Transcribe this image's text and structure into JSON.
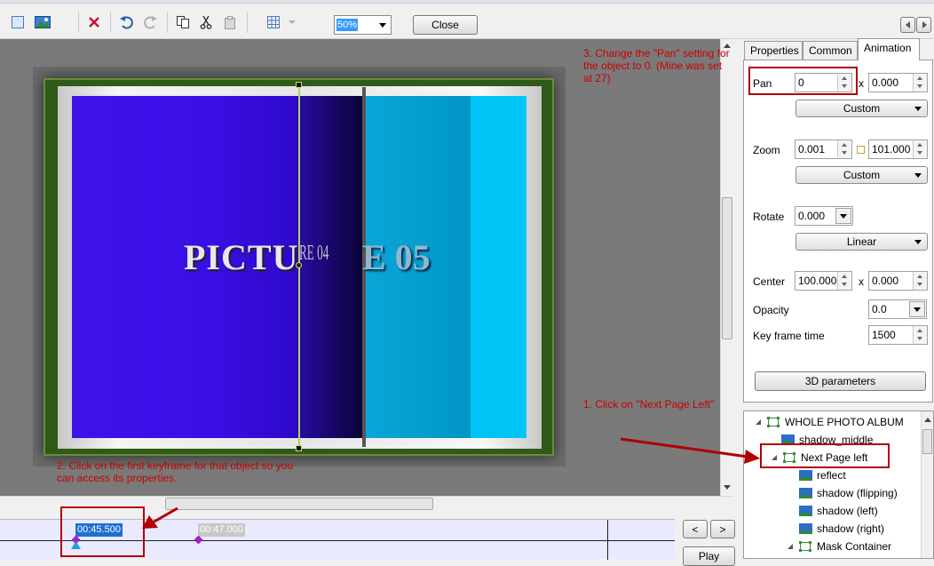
{
  "toolbar": {
    "zoom_value": "50%",
    "close_label": "Close",
    "icons": [
      "new-icon",
      "image-icon",
      "delete-icon",
      "undo-icon",
      "redo-icon",
      "copy-icon",
      "cut-icon",
      "paste-icon",
      "grid-icon"
    ]
  },
  "canvas": {
    "title_text": "PICTU",
    "title_text_flipped": "RE 04",
    "title_text_right": "E 05"
  },
  "tabs": [
    "Properties",
    "Common",
    "Animation"
  ],
  "properties": {
    "pan_label": "Pan",
    "pan_x": "0",
    "pan_sep": "x",
    "pan_y": "0.000",
    "pan_mode": "Custom",
    "zoom_label": "Zoom",
    "zoom_x": "0.001",
    "zoom_y": "101.000",
    "zoom_mode": "Custom",
    "rotate_label": "Rotate",
    "rotate_value": "0.000",
    "rotate_mode": "Linear",
    "center_label": "Center",
    "center_x": "100.000",
    "center_sep": "x",
    "center_y": "0.000",
    "opacity_label": "Opacity",
    "opacity_value": "0.0",
    "keyframe_label": "Key frame time",
    "keyframe_value": "1500",
    "params_button": "3D parameters"
  },
  "tree": {
    "items": [
      "WHOLE PHOTO ALBUM",
      "shadow_middle",
      "Next Page left",
      "reflect",
      "shadow (flipping)",
      "shadow (left)",
      "shadow (right)",
      "Mask Container"
    ]
  },
  "timeline": {
    "key1": "00:45.500",
    "key2": "00:47.000",
    "prev": "<",
    "next": ">",
    "play": "Play"
  },
  "annotations": {
    "note1": "1. Click on \"Next Page Left\"",
    "note2": "2. Click on the first keyframe for that object so you can access its properties.",
    "note3": "3. Change the \"Pan\" setting for the object to 0.  (Mine was set at 27)"
  },
  "colors": {
    "annotation": "#cc0000",
    "page_left": "#3a10e8",
    "page_right": "#0099cc"
  }
}
